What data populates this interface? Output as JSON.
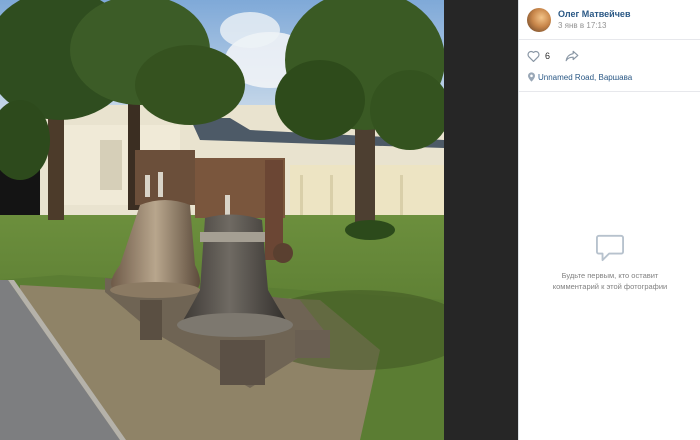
{
  "post": {
    "author": "Олег Матвейчев",
    "date": "3 янв в 17:13",
    "likes": "6",
    "location": "Unnamed Road, Варшава"
  },
  "comments": {
    "empty_line1": "Будьте первым, кто оставит",
    "empty_line2": "комментарий к этой фотографии"
  },
  "icons": {
    "like": "heart-icon",
    "share": "share-arrow-icon",
    "location": "map-pin-icon",
    "comments": "speech-bubble-icon"
  },
  "colors": {
    "link": "#2a5885",
    "muted": "#939393",
    "panel_bg": "#ffffff",
    "viewer_bg": "#141414"
  }
}
